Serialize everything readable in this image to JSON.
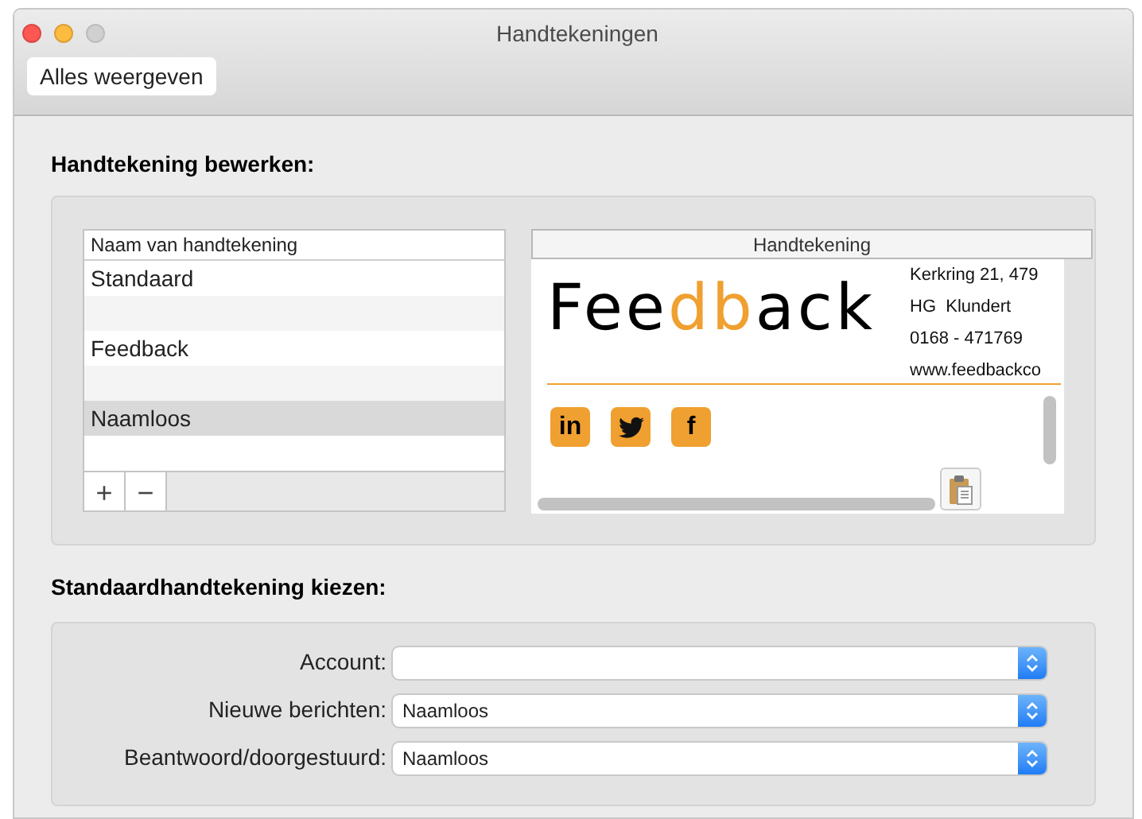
{
  "window": {
    "title": "Handtekeningen"
  },
  "toolbar": {
    "show_all_button": "Alles weergeven"
  },
  "edit_section": {
    "heading": "Handtekening bewerken:",
    "list": {
      "column": "Naam van handtekening",
      "rows": [
        {
          "name": "Standaard",
          "selected": false
        },
        {
          "selected": false
        },
        {
          "name": "Feedback",
          "selected": false
        },
        {
          "selected": false
        },
        {
          "name": "Naamloos",
          "selected": true
        }
      ],
      "add_button": "+",
      "remove_button": "−"
    },
    "preview": {
      "column": "Handtekening",
      "logo_segments": [
        {
          "text": "Fee",
          "accent": false
        },
        {
          "text": "db",
          "accent": true
        },
        {
          "text": "ack",
          "accent": false
        }
      ],
      "address_lines": [
        "Kerkring 21, 479",
        "HG  Klundert",
        "0168 - 471769",
        "www.feedbackco"
      ],
      "social": [
        {
          "kind": "text",
          "label": "in"
        },
        {
          "kind": "bird"
        },
        {
          "kind": "text",
          "label": "f"
        }
      ]
    }
  },
  "default_section": {
    "heading": "Standaardhandtekening kiezen:",
    "fields": [
      {
        "label": "Account:"
      },
      {
        "label": "Nieuwe berichten:",
        "value": "Naamloos"
      },
      {
        "label": "Beantwoord/doorgestuurd:",
        "value": "Naamloos"
      }
    ]
  }
}
